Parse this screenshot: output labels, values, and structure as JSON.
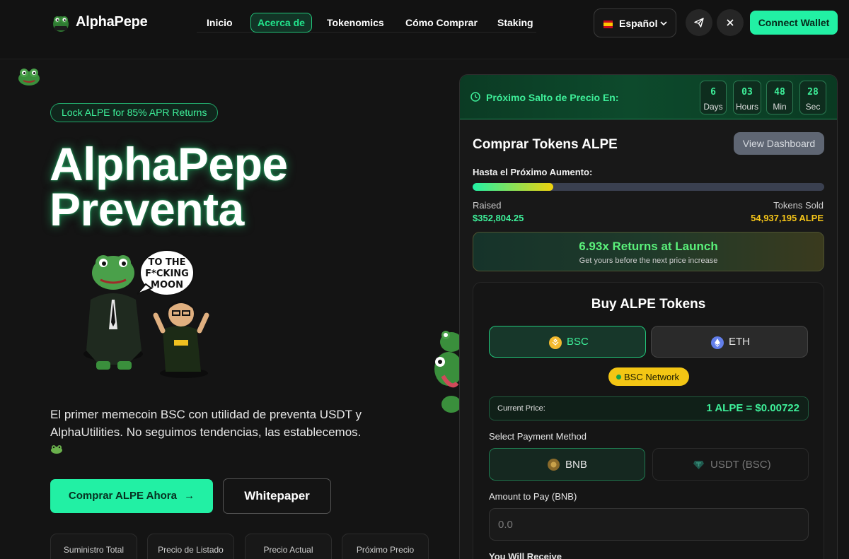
{
  "brand": {
    "name": "AlphaPepe"
  },
  "nav": {
    "links": [
      "Inicio",
      "Acerca de",
      "Tokenomics",
      "Cómo Comprar",
      "Staking"
    ],
    "active_index": 1,
    "language": "Español",
    "connect_label": "Connect Wallet"
  },
  "hero": {
    "badge": "Lock ALPE for 85% APR Returns",
    "title_line1": "AlphaPepe",
    "title_line2": "Preventa",
    "speech_bubble": [
      "TO THE",
      "F*CKING",
      "MOON"
    ],
    "description": "El primer memecoin BSC con utilidad de preventa USDT y AlphaUtilities. No seguimos tendencias, las establecemos.",
    "buy_label": "Comprar ALPE Ahora",
    "buy_arrow": "→",
    "whitepaper_label": "Whitepaper",
    "stats": [
      "Suministro Total",
      "Precio de Listado",
      "Precio Actual",
      "Próximo Precio"
    ]
  },
  "presale": {
    "timer_label": "Próximo Salto de Precio En:",
    "countdown": [
      {
        "value": "6",
        "unit": "Days"
      },
      {
        "value": "03",
        "unit": "Hours"
      },
      {
        "value": "48",
        "unit": "Min"
      },
      {
        "value": "28",
        "unit": "Sec"
      }
    ],
    "buy_title": "Comprar Tokens ALPE",
    "dashboard_label": "View Dashboard",
    "next_increase_label": "Hasta el Próximo Aumento:",
    "progress_fraction": 0.23,
    "raised_label": "Raised",
    "raised_value": "$352,804.25",
    "sold_label": "Tokens Sold",
    "sold_value": "54,937,195 ALPE",
    "returns_title": "6.93x Returns at Launch",
    "returns_sub": "Get yours before the next price increase",
    "card_title": "Buy ALPE Tokens",
    "networks": [
      {
        "label": "BSC",
        "selected": true,
        "icon": "bnb-icon"
      },
      {
        "label": "ETH",
        "selected": false,
        "icon": "eth-icon"
      }
    ],
    "network_pill": "BSC Network",
    "current_price_label": "Current Price:",
    "current_price_value": "1 ALPE = $0.00722",
    "payment_label": "Select Payment Method",
    "payment_methods": [
      {
        "label": "BNB",
        "selected": true
      },
      {
        "label": "USDT (BSC)",
        "selected": false
      }
    ],
    "amount_label": "Amount to Pay (BNB)",
    "amount_placeholder": "0.0",
    "receive_label": "You Will Receive"
  },
  "colors": {
    "accent": "#22f0a4",
    "accent_text": "#3ef09a",
    "gold": "#f5c518",
    "background": "#141414"
  }
}
